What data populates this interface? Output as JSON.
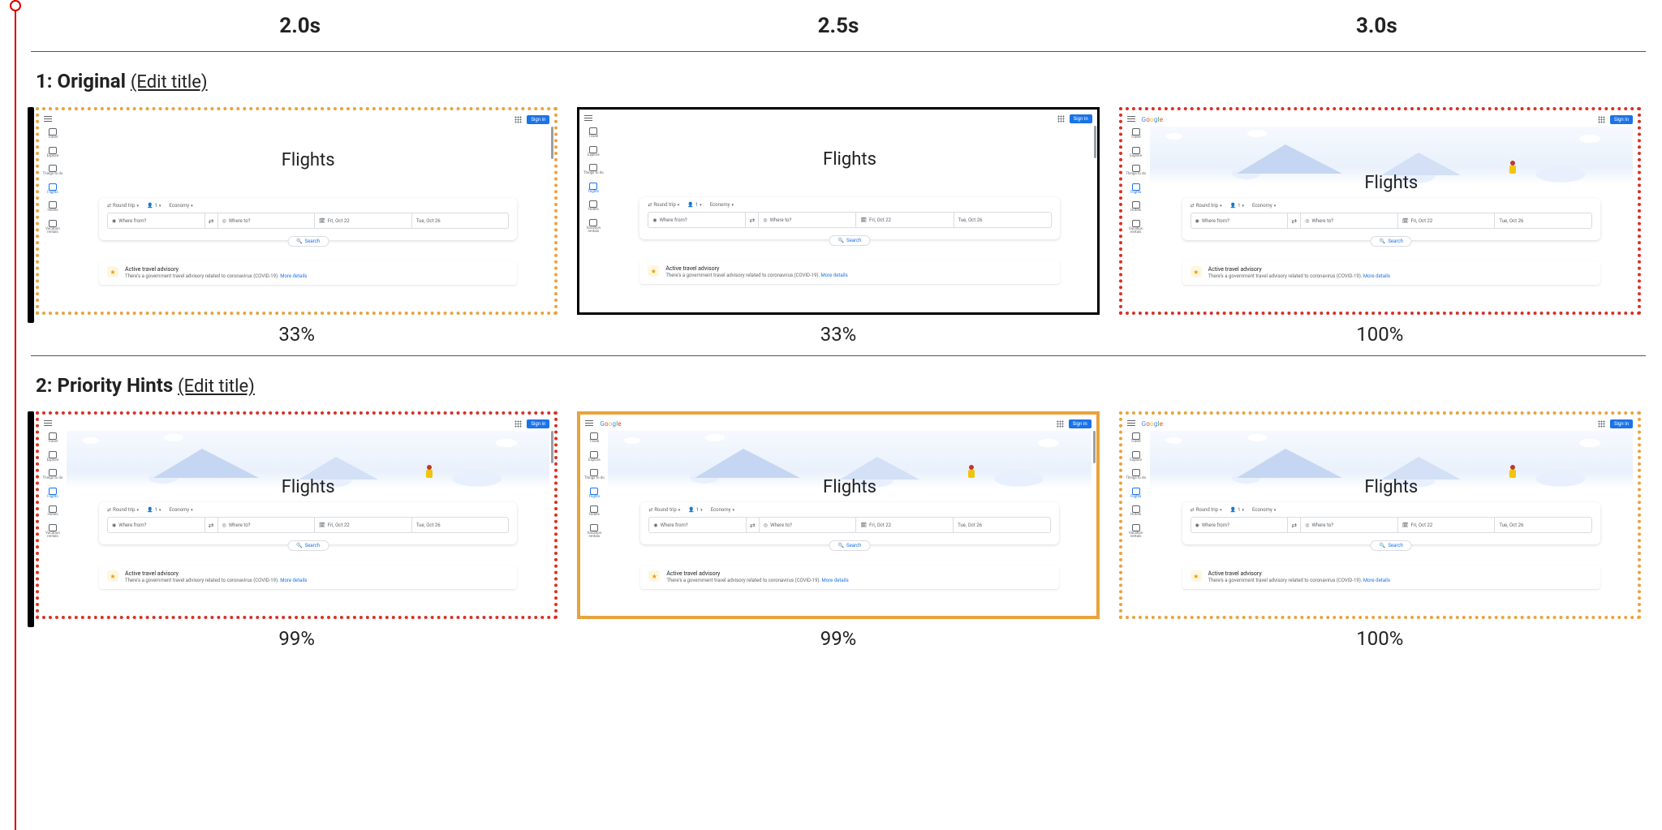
{
  "time_headers": [
    "2.0s",
    "2.5s",
    "3.0s"
  ],
  "rows": [
    {
      "index": "1",
      "name": "Original",
      "edit_label": "(Edit title)",
      "percentages": [
        "33%",
        "33%",
        "100%"
      ],
      "borders": [
        "dotted-orange",
        "solid-black",
        "dotted-red"
      ],
      "hero_loaded": [
        false,
        false,
        true
      ],
      "logo_loaded": [
        false,
        false,
        true
      ],
      "black_edge": true
    },
    {
      "index": "2",
      "name": "Priority Hints",
      "edit_label": "(Edit title)",
      "percentages": [
        "99%",
        "99%",
        "100%"
      ],
      "borders": [
        "dotted-red",
        "solid-orange",
        "dotted-orange"
      ],
      "hero_loaded": [
        true,
        true,
        true
      ],
      "logo_loaded": [
        false,
        true,
        true
      ],
      "black_edge": true
    }
  ],
  "flights": {
    "brand_html": "Google",
    "sign_in": "Sign in",
    "sidebar_items": [
      "Travel",
      "Explore",
      "Things to do",
      "Flights",
      "Hotels",
      "Vacation rentals"
    ],
    "sidebar_active_index": 3,
    "title": "Flights",
    "trip_type": "Round trip",
    "passengers": "1",
    "cabin": "Economy",
    "from_placeholder": "Where from?",
    "to_placeholder": "Where to?",
    "date_out": "Fri, Oct 22",
    "date_back": "Tue, Oct 26",
    "search_label": "Search",
    "advisory_title": "Active travel advisory",
    "advisory_body": "There's a government travel advisory related to coronavirus (COVID-19).",
    "advisory_link": "More details"
  }
}
